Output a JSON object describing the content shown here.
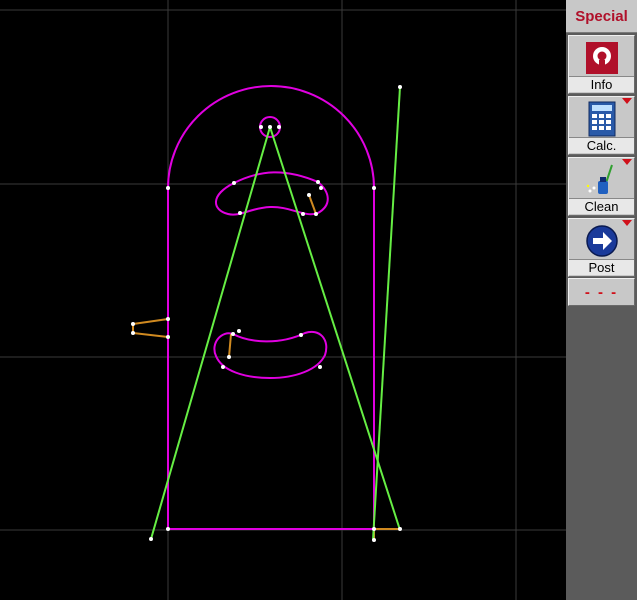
{
  "sidebar": {
    "title": "Special",
    "tools": [
      {
        "label": "Info",
        "icon": "info-icon",
        "has_submenu": false
      },
      {
        "label": "Calc.",
        "icon": "calculator-icon",
        "has_submenu": true
      },
      {
        "label": "Clean",
        "icon": "clean-icon",
        "has_submenu": true
      },
      {
        "label": "Post",
        "icon": "arrow-right-icon",
        "has_submenu": true
      }
    ],
    "more_label": "- - -"
  },
  "colors": {
    "background": "#000000",
    "grid": "#3a3a3a",
    "profile": "#e000e0",
    "construction": "#66ee44",
    "lead": "#d08a20",
    "vertex": "#ffffff",
    "sidebar": "#5b5b5b",
    "accent": "#d0101a"
  }
}
